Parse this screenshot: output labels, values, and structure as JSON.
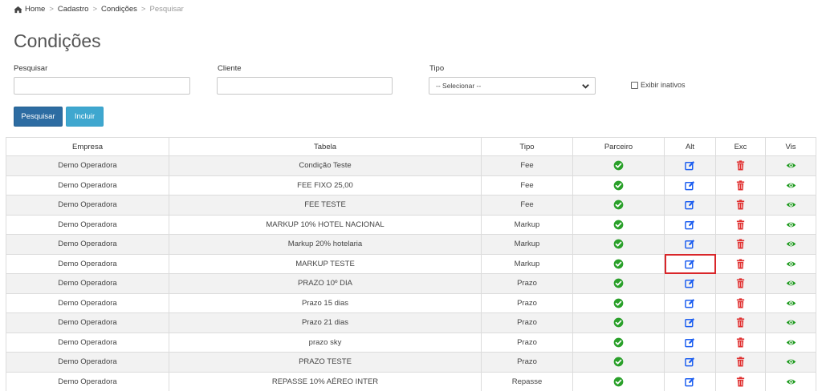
{
  "breadcrumb": {
    "home": "Home",
    "level1": "Cadastro",
    "level2": "Condições",
    "current": "Pesquisar",
    "separator": ">"
  },
  "page": {
    "title": "Condições"
  },
  "filters": {
    "search_label": "Pesquisar",
    "search_value": "",
    "client_label": "Cliente",
    "client_value": "",
    "type_label": "Tipo",
    "type_selected": "-- Selecionar --",
    "show_inactive_label": "Exibir inativos"
  },
  "actions": {
    "search_button": "Pesquisar",
    "add_button": "Incluir"
  },
  "table": {
    "headers": {
      "empresa": "Empresa",
      "tabela": "Tabela",
      "tipo": "Tipo",
      "parceiro": "Parceiro",
      "alt": "Alt",
      "exc": "Exc",
      "vis": "Vis"
    },
    "rows": [
      {
        "empresa": "Demo Operadora",
        "tabela": "Condição Teste",
        "tipo": "Fee"
      },
      {
        "empresa": "Demo Operadora",
        "tabela": "FEE FIXO 25,00",
        "tipo": "Fee"
      },
      {
        "empresa": "Demo Operadora",
        "tabela": "FEE TESTE",
        "tipo": "Fee"
      },
      {
        "empresa": "Demo Operadora",
        "tabela": "MARKUP 10% HOTEL NACIONAL",
        "tipo": "Markup"
      },
      {
        "empresa": "Demo Operadora",
        "tabela": "Markup 20% hotelaria",
        "tipo": "Markup"
      },
      {
        "empresa": "Demo Operadora",
        "tabela": "MARKUP TESTE",
        "tipo": "Markup"
      },
      {
        "empresa": "Demo Operadora",
        "tabela": "PRAZO 10º DIA",
        "tipo": "Prazo"
      },
      {
        "empresa": "Demo Operadora",
        "tabela": "Prazo 15 dias",
        "tipo": "Prazo"
      },
      {
        "empresa": "Demo Operadora",
        "tabela": "Prazo 21 dias",
        "tipo": "Prazo"
      },
      {
        "empresa": "Demo Operadora",
        "tabela": "prazo sky",
        "tipo": "Prazo"
      },
      {
        "empresa": "Demo Operadora",
        "tabela": "PRAZO TESTE",
        "tipo": "Prazo"
      },
      {
        "empresa": "Demo Operadora",
        "tabela": "REPASSE 10% AÉREO INTER",
        "tipo": "Repasse"
      }
    ],
    "highlighted_edit_row": 5,
    "icons": {
      "partner": "check-circle-icon",
      "edit": "edit-icon",
      "delete": "trash-icon",
      "view": "eye-icon"
    }
  },
  "colors": {
    "primary_button": "#2d6ca2",
    "info_button": "#3fa7cf",
    "check_green": "#2aa02a",
    "edit_blue": "#1e5ff0",
    "delete_red": "#e03030",
    "view_green": "#1e9a1e",
    "highlight_border": "#d9262a"
  }
}
